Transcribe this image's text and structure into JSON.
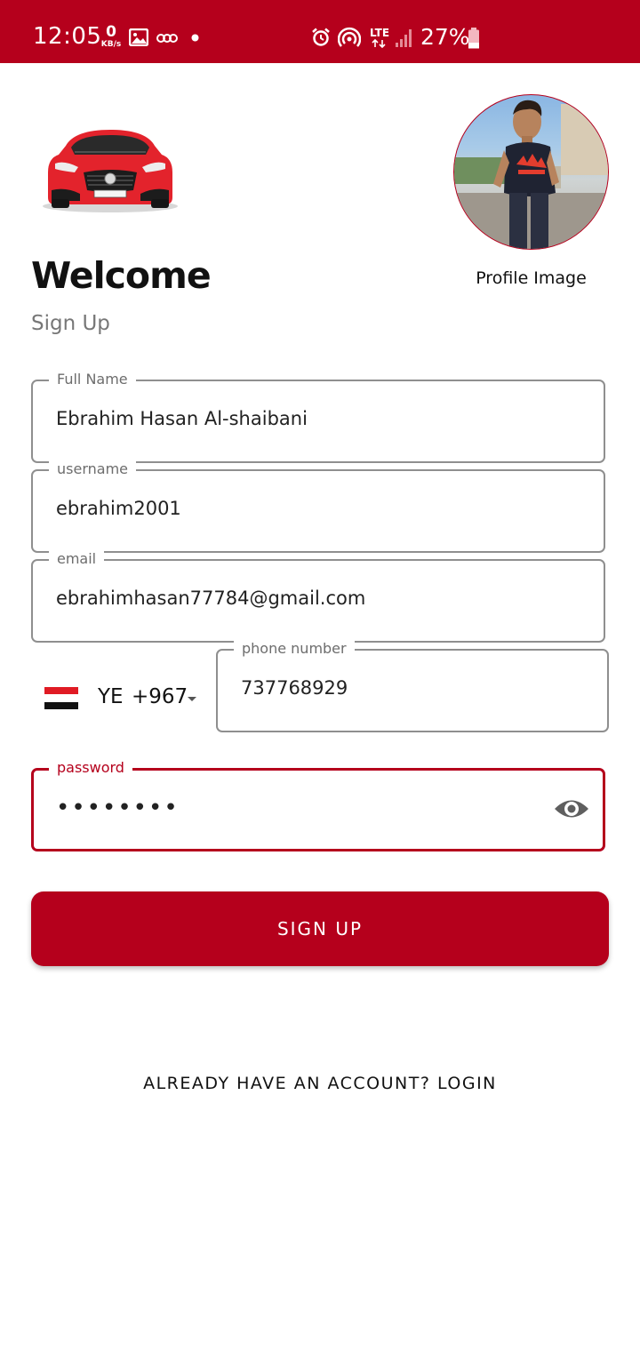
{
  "status_bar": {
    "time": "12:05",
    "net_speed_value": "0",
    "net_speed_unit": "KB/s",
    "network_type": "LTE",
    "battery_percent": "27%",
    "background_color": "#b5001c",
    "icons": [
      "image-icon",
      "voicemail-icon",
      "dot-icon",
      "alarm-icon",
      "hotspot-icon",
      "lte-icon",
      "signal-icon",
      "battery-icon"
    ]
  },
  "header": {
    "title": "Welcome",
    "subtitle": "Sign Up",
    "profile_image_label": "Profile Image"
  },
  "form": {
    "full_name": {
      "label": "Full Name",
      "value": "Ebrahim Hasan Al-shaibani"
    },
    "username": {
      "label": "username",
      "value": "ebrahim2001"
    },
    "email": {
      "label": "email",
      "value": "ebrahimhasan77784@gmail.com"
    },
    "country": {
      "code": "YE",
      "dial_code": "+967"
    },
    "phone": {
      "label": "phone number",
      "value": "737768929"
    },
    "password": {
      "label": "password",
      "value": "••••••••"
    }
  },
  "actions": {
    "signup_label": "SIGN UP",
    "login_link_label": "ALREADY HAVE AN ACCOUNT? LOGIN"
  },
  "colors": {
    "accent": "#b5001c",
    "border": "#8f8f8f"
  }
}
